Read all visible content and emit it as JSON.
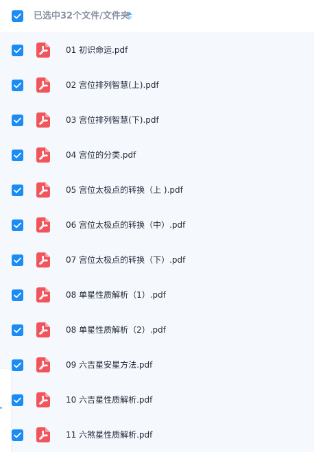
{
  "header": {
    "select_all_checked": true,
    "selection_label": "已选中32个文件/文件夹",
    "sort_icon": "sort-updown-icon"
  },
  "files": [
    {
      "name": "01 初识命运.pdf",
      "checked": true,
      "icon": "pdf-icon"
    },
    {
      "name": "02 宫位排列智慧(上).pdf",
      "checked": true,
      "icon": "pdf-icon"
    },
    {
      "name": "03 宫位排列智慧(下).pdf",
      "checked": true,
      "icon": "pdf-icon"
    },
    {
      "name": "04 宫位的分类.pdf",
      "checked": true,
      "icon": "pdf-icon"
    },
    {
      "name": "05 宫位太极点的转换（上 ).pdf",
      "checked": true,
      "icon": "pdf-icon"
    },
    {
      "name": "06 宫位太极点的转换（中）.pdf",
      "checked": true,
      "icon": "pdf-icon"
    },
    {
      "name": "07 宫位太极点的转换（下）.pdf",
      "checked": true,
      "icon": "pdf-icon"
    },
    {
      "name": "08 单星性质解析（1）.pdf",
      "checked": true,
      "icon": "pdf-icon"
    },
    {
      "name": "08 单星性质解析（2）.pdf",
      "checked": true,
      "icon": "pdf-icon"
    },
    {
      "name": "09 六吉星安星方法.pdf",
      "checked": true,
      "icon": "pdf-icon"
    },
    {
      "name": "10 六吉星性质解析.pdf",
      "checked": true,
      "icon": "pdf-icon"
    },
    {
      "name": "11 六煞星性质解析.pdf",
      "checked": true,
      "icon": "pdf-icon"
    }
  ],
  "colors": {
    "checkbox": "#1b8cf5",
    "pdf_icon": "#f0555b",
    "list_background": "#f5f9fe",
    "header_text": "#8a93a3",
    "file_text": "#1f2633"
  }
}
